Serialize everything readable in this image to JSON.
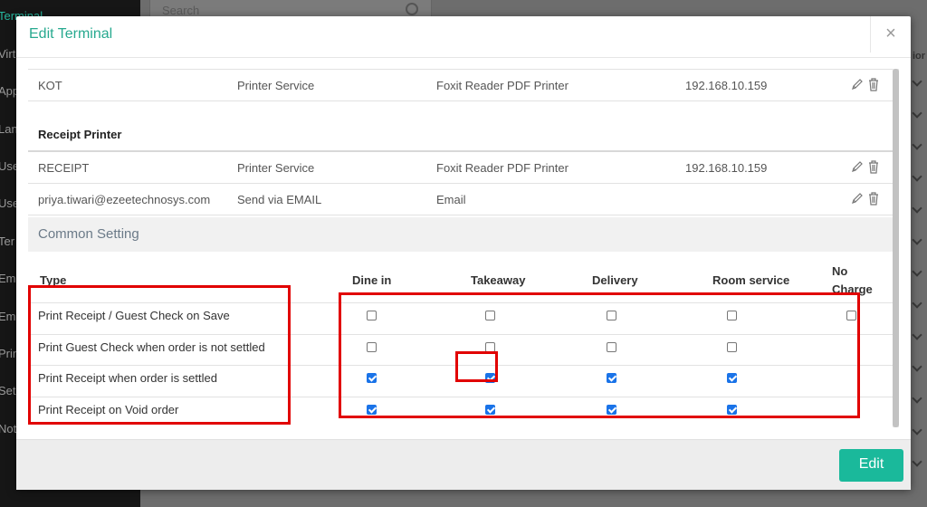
{
  "background": {
    "sidebar_items": [
      "Terminal",
      "Virt",
      "App",
      "Lan",
      "Use",
      "Use",
      "Ter",
      "Em",
      "Em",
      "Prin",
      "Set",
      "Not"
    ],
    "search_placeholder": "Search",
    "right_header": "ior"
  },
  "modal": {
    "title": "Edit Terminal",
    "close_label": "×",
    "printer_rows_top": [
      {
        "name": "KOT",
        "service": "Printer Service",
        "printer": "Foxit Reader PDF Printer",
        "address": "192.168.10.159"
      }
    ],
    "receipt_group_title": "Receipt Printer",
    "printer_rows_receipt": [
      {
        "name": "RECEIPT",
        "service": "Printer Service",
        "printer": "Foxit Reader PDF Printer",
        "address": "192.168.10.159"
      },
      {
        "name": "priya.tiwari@ezeetechnosys.com",
        "service": "Send via EMAIL",
        "printer": "Email",
        "address": ""
      }
    ],
    "common_setting_title": "Common Setting",
    "settings_table": {
      "headers": [
        "Type",
        "Dine in",
        "Takeaway",
        "Delivery",
        "Room service",
        "No",
        "Charge"
      ],
      "rows": [
        {
          "type": "Print Receipt / Guest Check on Save",
          "checks": [
            false,
            false,
            false,
            false,
            false
          ]
        },
        {
          "type": "Print Guest Check when order is not settled",
          "checks": [
            false,
            false,
            false,
            false,
            null
          ]
        },
        {
          "type": "Print Receipt when order is settled",
          "checks": [
            true,
            true,
            true,
            true,
            null
          ]
        },
        {
          "type": "Print Receipt on Void order",
          "checks": [
            true,
            true,
            true,
            true,
            null
          ]
        }
      ]
    },
    "edit_button": "Edit",
    "colors": {
      "accent": "#1ab99b",
      "title": "#27a98f",
      "annotation": "#e10000",
      "checkbox": "#1a73e8"
    }
  }
}
